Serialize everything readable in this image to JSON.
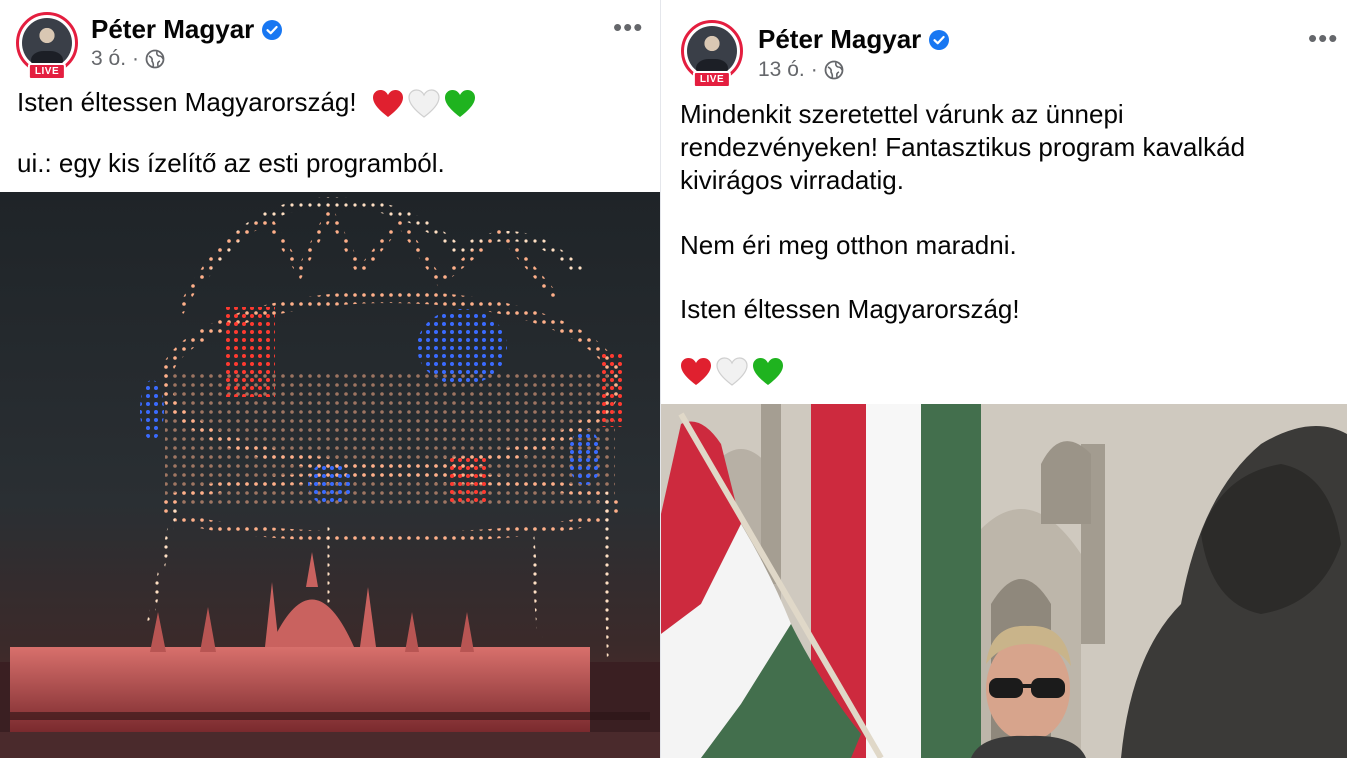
{
  "left_post": {
    "author_name": "Péter Magyar",
    "live_badge": "LIVE",
    "time": "3 ó.",
    "separator": "·",
    "audience_icon": "globe-icon",
    "verified_icon": "verified-badge-icon",
    "more_label": "•••",
    "line1": "Isten éltessen Magyarország!",
    "line2": "ui.: egy kis ízelítő az esti programból.",
    "image_description_icon": "drone-crown-show-photo"
  },
  "right_post": {
    "author_name": "Péter Magyar",
    "live_badge": "LIVE",
    "time": "13 ó.",
    "separator": "·",
    "audience_icon": "globe-icon",
    "verified_icon": "verified-badge-icon",
    "more_label": "•••",
    "para1_line1": "Mindenkit szeretettel várunk az ünnepi",
    "para1_line2": "rendezvényeken! Fantasztikus program kavalkád",
    "para1_line3": "kivirágos virradatig.",
    "para2": "Nem éri meg otthon maradni.",
    "para3": "Isten éltessen Magyarország!",
    "image_description_icon": "flag-parliament-photo"
  },
  "colors": {
    "verified": "#1877f2",
    "live": "#e41e3f",
    "flag_red": "#cd2a3e",
    "flag_white": "#ffffff",
    "flag_green": "#436f4d"
  }
}
